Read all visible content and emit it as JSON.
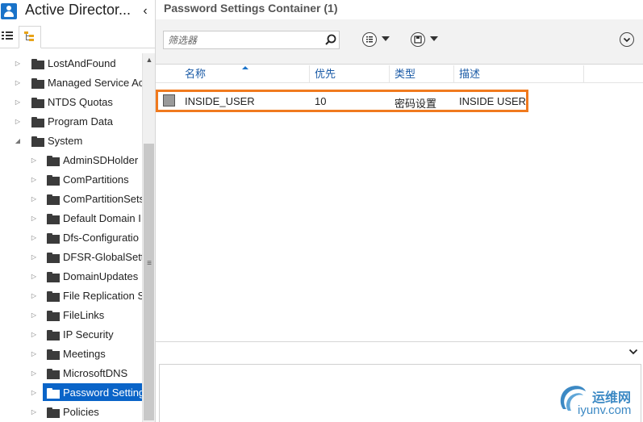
{
  "app": {
    "title": "Active Director...",
    "collapse_glyph": "‹"
  },
  "nav": {
    "tree": [
      {
        "label": "LostAndFound",
        "level": 0,
        "expanded": false
      },
      {
        "label": "Managed Service Ac",
        "level": 0,
        "expanded": false
      },
      {
        "label": "NTDS Quotas",
        "level": 0,
        "expanded": false
      },
      {
        "label": "Program Data",
        "level": 0,
        "expanded": false
      },
      {
        "label": "System",
        "level": 0,
        "expanded": true
      },
      {
        "label": "AdminSDHolder",
        "level": 1,
        "expanded": false
      },
      {
        "label": "ComPartitions",
        "level": 1,
        "expanded": false
      },
      {
        "label": "ComPartitionSets",
        "level": 1,
        "expanded": false
      },
      {
        "label": "Default Domain I",
        "level": 1,
        "expanded": false
      },
      {
        "label": "Dfs-Configuratio",
        "level": 1,
        "expanded": false
      },
      {
        "label": "DFSR-GlobalSett",
        "level": 1,
        "expanded": false
      },
      {
        "label": "DomainUpdates",
        "level": 1,
        "expanded": false
      },
      {
        "label": "File Replication S",
        "level": 1,
        "expanded": false
      },
      {
        "label": "FileLinks",
        "level": 1,
        "expanded": false
      },
      {
        "label": "IP Security",
        "level": 1,
        "expanded": false
      },
      {
        "label": "Meetings",
        "level": 1,
        "expanded": false
      },
      {
        "label": "MicrosoftDNS",
        "level": 1,
        "expanded": false
      },
      {
        "label": "Password Setting",
        "level": 1,
        "expanded": false,
        "selected": true
      },
      {
        "label": "Policies",
        "level": 1,
        "expanded": false
      }
    ]
  },
  "container": {
    "title": "Password Settings Container  (1)"
  },
  "toolbar": {
    "filter_placeholder": "筛选器"
  },
  "grid": {
    "columns": [
      "名称",
      "优先",
      "类型",
      "描述",
      ""
    ],
    "sort_column": "名称",
    "rows": [
      {
        "name": "INSIDE_USER",
        "priority": "10",
        "type": "密码设置",
        "description": "INSIDE USER"
      }
    ]
  },
  "watermark": {
    "name": "运维网",
    "domain": "iyunv.com"
  },
  "colors": {
    "accent": "#0a64c8",
    "highlight_border": "#f07a1e",
    "header_link": "#1a5aa6",
    "watermark": "#3c89c4"
  }
}
